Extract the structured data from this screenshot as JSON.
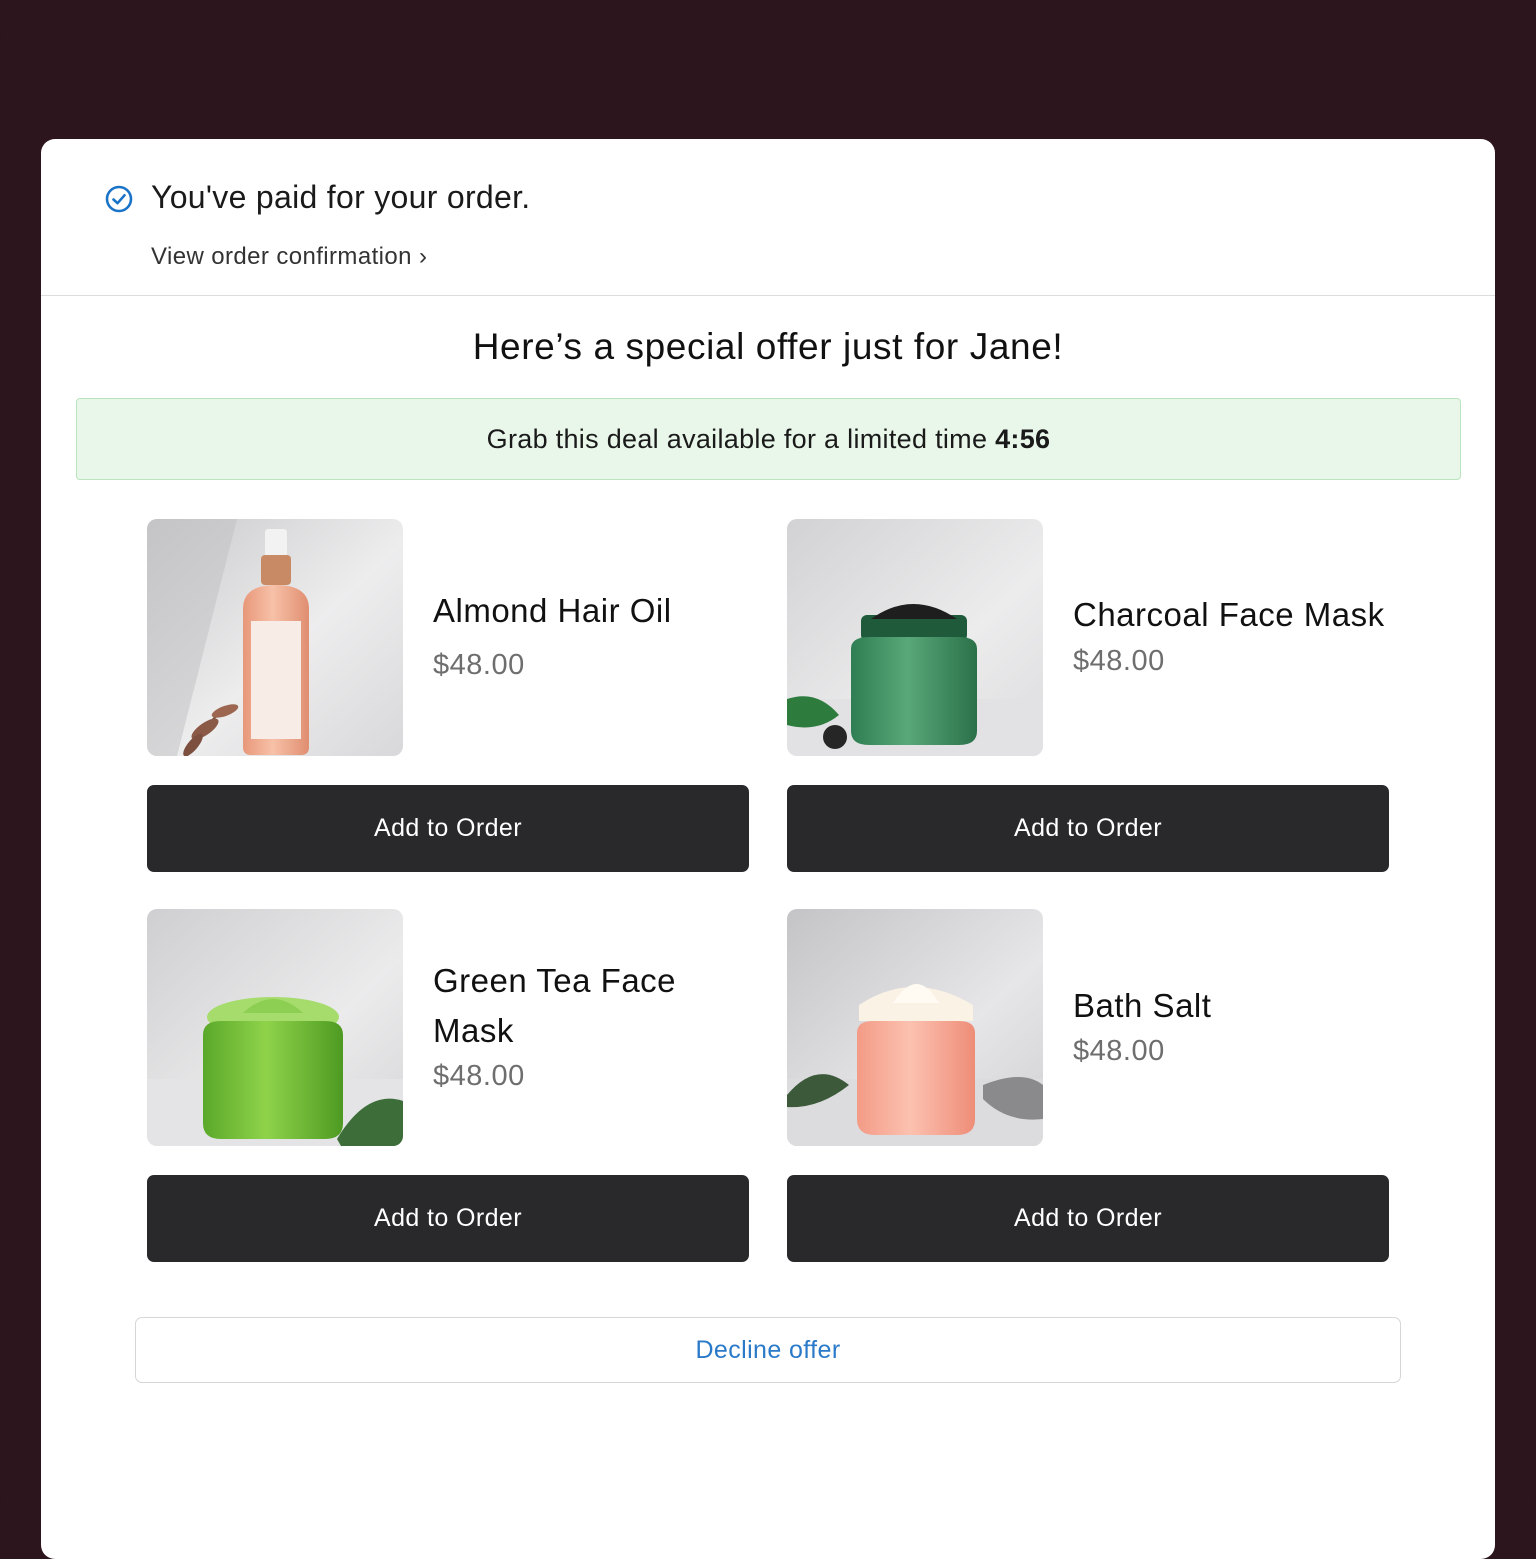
{
  "confirmation": {
    "title": "You've paid for your order.",
    "link_text": "View order confirmation ›"
  },
  "offer": {
    "heading": "Here’s a special offer just for Jane!",
    "banner_text": "Grab this deal available for a limited time ",
    "timer": "4:56"
  },
  "products": [
    {
      "name": "Almond Hair Oil",
      "price": "$48.00",
      "button": "Add to Order",
      "image": "hair-oil-bottle"
    },
    {
      "name": "Charcoal Face Mask",
      "price": "$48.00",
      "button": "Add to Order",
      "image": "charcoal-jar"
    },
    {
      "name": "Green Tea Face Mask",
      "price": "$48.00",
      "button": "Add to Order",
      "image": "green-tea-jar"
    },
    {
      "name": "Bath Salt",
      "price": "$48.00",
      "button": "Add to Order",
      "image": "cream-jar"
    }
  ],
  "decline_label": "Decline offer",
  "colors": {
    "background": "#2c151c",
    "banner_bg": "#e9f7ea",
    "button_bg": "#29282b",
    "link_blue": "#2a7ac9",
    "check_blue": "#1b73c8"
  }
}
